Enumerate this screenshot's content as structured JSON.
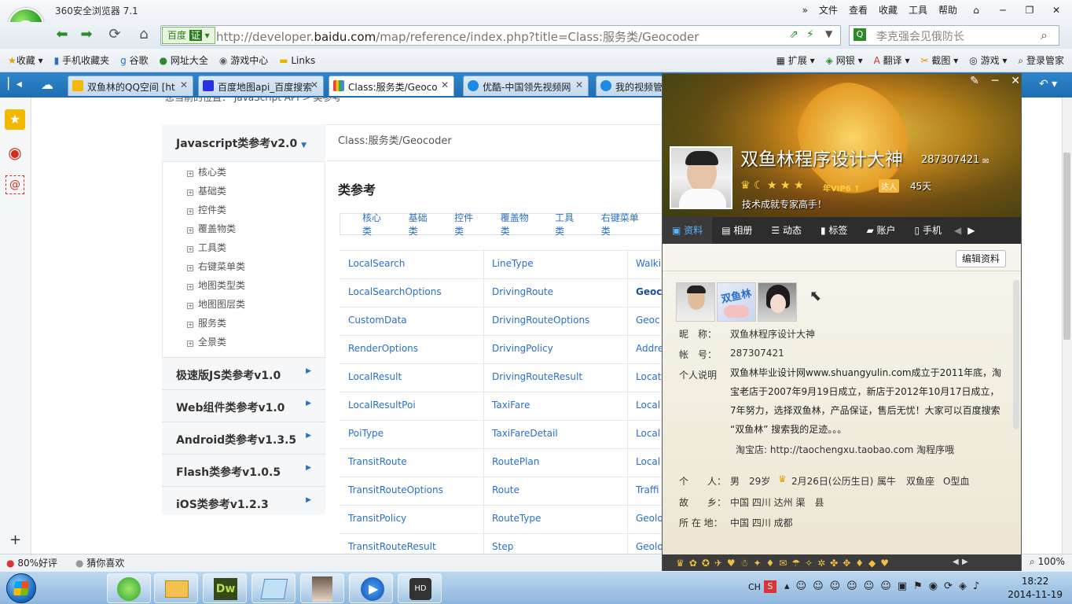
{
  "window": {
    "app_title": "360安全浏览器 7.1",
    "menus": [
      "文件",
      "查看",
      "收藏",
      "工具",
      "帮助"
    ]
  },
  "address": {
    "badge": "百度",
    "badge_tag": "证",
    "url_prefix": "http://developer.",
    "url_domain": "baidu.com",
    "url_path": "/map/reference/index.php?title=Class:服务类/Geocoder",
    "search_placeholder": "李克强会见俄防长"
  },
  "bookmarks": {
    "left": [
      "收藏",
      "手机收藏夹",
      "谷歌",
      "网址大全",
      "游戏中心",
      "Links"
    ],
    "right": [
      "扩展",
      "网银",
      "翻译",
      "截图",
      "游戏",
      "登录管家"
    ]
  },
  "tabs": [
    {
      "label": "双鱼林的QQ空间 [ht",
      "color": "#f5b800"
    },
    {
      "label": "百度地图api_百度搜索",
      "color": "#2932e1"
    },
    {
      "label": "Class:服务类/Geoco",
      "color": "#ffffff",
      "active": true
    },
    {
      "label": "优酷-中国领先视频网",
      "color": "#1e88e5"
    },
    {
      "label": "我的视频管",
      "color": "#1e88e5"
    }
  ],
  "page": {
    "crumb": "您当前的位置： JavaScript API > 类参考",
    "nav_head": "Javascript类参考v2.0",
    "nav_items": [
      "核心类",
      "基础类",
      "控件类",
      "覆盖物类",
      "工具类",
      "右键菜单类",
      "地图类型类",
      "地图图层类",
      "服务类",
      "全景类"
    ],
    "nav_sections": [
      "极速版JS类参考v1.0",
      "Web组件类参考v1.0",
      "Android类参考v1.3.5",
      "Flash类参考v1.0.5",
      "iOS类参考v1.2.3"
    ],
    "content_title": "Class:服务类/Geocoder",
    "section_title": "类参考",
    "filters": [
      "核心类",
      "基础类",
      "控件类",
      "覆盖物类",
      "工具类",
      "右键菜单类"
    ],
    "table": [
      [
        "LocalSearch",
        "LineType",
        "Walki"
      ],
      [
        "LocalSearchOptions",
        "DrivingRoute",
        "Geoc"
      ],
      [
        "CustomData",
        "DrivingRouteOptions",
        "Geoc"
      ],
      [
        "RenderOptions",
        "DrivingPolicy",
        "Addre"
      ],
      [
        "LocalResult",
        "DrivingRouteResult",
        "Locat"
      ],
      [
        "LocalResultPoi",
        "TaxiFare",
        "Local"
      ],
      [
        "PoiType",
        "TaxiFareDetail",
        "Local"
      ],
      [
        "TransitRoute",
        "RoutePlan",
        "Local"
      ],
      [
        "TransitRouteOptions",
        "Route",
        "Traffi"
      ],
      [
        "TransitPolicy",
        "RouteType",
        "Geolo"
      ],
      [
        "TransitRouteResult",
        "Step",
        "Geolo"
      ]
    ]
  },
  "status": {
    "rating": "80%好评",
    "guess": "猜你喜欢",
    "zoom": "100%"
  },
  "qq": {
    "name": "双鱼林程序设计大神",
    "number": "287307421",
    "vip": "年VIP6",
    "talent": "达人",
    "days": "45天",
    "motto": "技术成就专家高手！",
    "tabs": [
      "资料",
      "相册",
      "动态",
      "标签",
      "账户",
      "手机"
    ],
    "edit_label": "编辑资料",
    "fields": {
      "nick_label": "昵　称：",
      "nick": "双鱼林程序设计大神",
      "acct_label": "帐　号：",
      "acct": "287307421",
      "desc_label": "个人说明",
      "desc": "双鱼林毕业设计网www.shuangyulin.com成立于2011年底，淘宝老店于2007年9月19日成立，新店于2012年10月17日成立，7年努力，选择双鱼林，产品保证，售后无忧！大家可以百度搜索 “双鱼林” 搜索我的足迹。。。",
      "shop": "淘宝店: http://taochengxu.taobao.com 淘程序哦",
      "person_label": "个　　人：",
      "gender": "男",
      "age": "29岁",
      "birthday": "2月26日(公历生日)",
      "zodiac": "属牛",
      "star": "双鱼座",
      "blood": "O型血",
      "home_label": "故　　乡：",
      "home": "中国 四川 达州 渠　县",
      "loc_label": "所 在 地：",
      "loc": "中国 四川 成都"
    }
  },
  "taskbar": {
    "time": "18:22",
    "date": "2014-11-19",
    "ime": "CH"
  }
}
